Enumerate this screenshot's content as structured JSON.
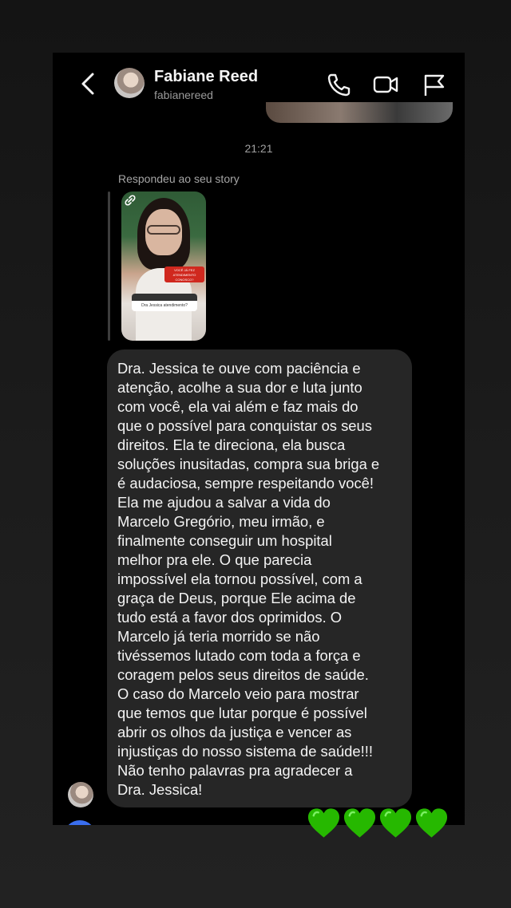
{
  "header": {
    "name": "Fabiane Reed",
    "username": "fabianereed",
    "icons": [
      "back-arrow-icon",
      "phone-icon",
      "video-camera-icon",
      "flag-icon"
    ]
  },
  "thread": {
    "timestamp": "21:21",
    "story_reply_label": "Respondeu ao seu story",
    "message": "Dra. Jessica te ouve com paciência e\natenção, acolhe a sua dor e luta junto\ncom você, ela vai além e faz mais do\nque o possível para conquistar os seus\ndireitos. Ela te direciona, ela busca\nsoluções inusitadas, compra sua briga e\né audaciosa, sempre respeitando você!\nEla me ajudou a salvar a vida do\nMarcelo Gregório, meu irmão, e\nfinalmente conseguir um hospital\nmelhor pra ele. O que parecia\nimpossível ela tornou possível, com a\ngraça de Deus, porque Ele acima de\ntudo está a favor dos oprimidos. O\nMarcelo já teria morrido se não\ntivéssemos lutado com toda a força e\ncoragem pelos seus direitos de saúde.\nO caso do Marcelo veio para mostrar\nque temos que lutar porque é possível\nabrir os olhos da justiça e vencer as\ninjustiças do nosso sistema de saúde!!!\nNão tenho palavras pra agradecer a\nDra. Jessica!"
  },
  "story_thumbnail": {
    "sticker_text": "VOCÊ JÁ FEZ ATENDIMENTO CONOSCO?",
    "question_text": "Dra Jessica atendimento?"
  },
  "overlay": {
    "emoji": "💚💚💚💚",
    "emoji_color": "#26b800"
  },
  "colors": {
    "background": "#000000",
    "bubble": "#262626",
    "text": "#f4f4f4",
    "muted": "#9a9a9a"
  }
}
